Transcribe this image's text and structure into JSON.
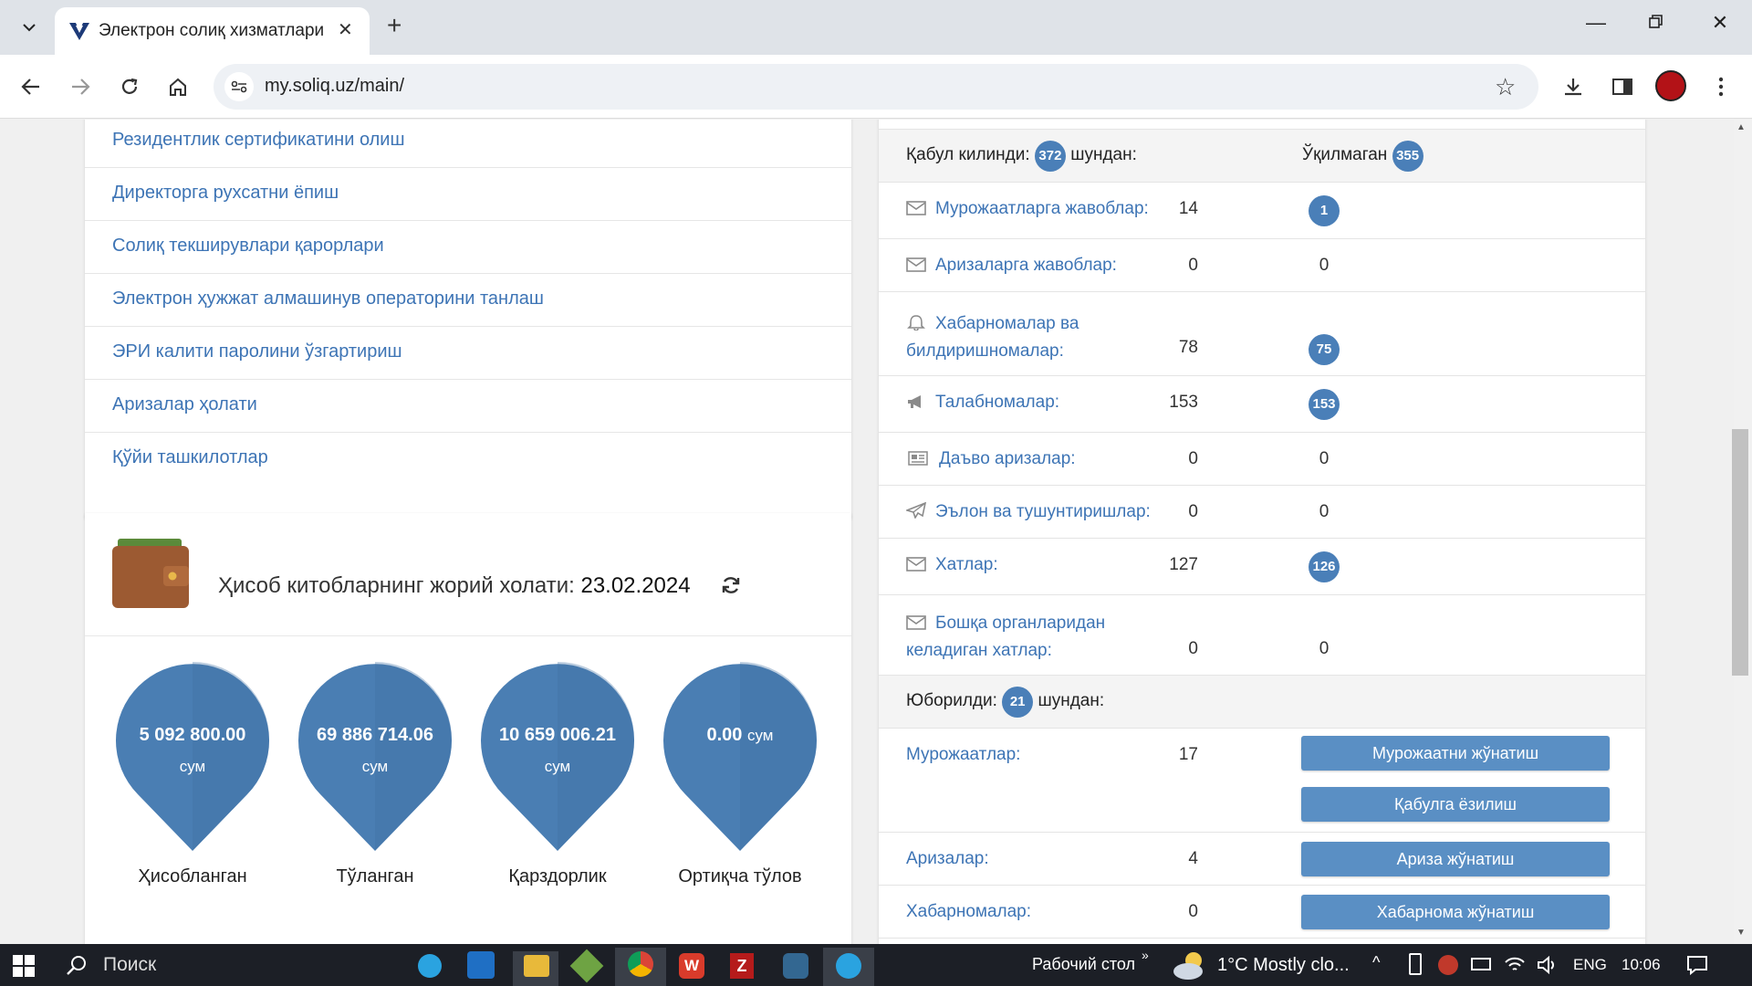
{
  "browser": {
    "tab_title": "Электрон солиқ хизматлари",
    "url": "my.soliq.uz/main/"
  },
  "menu": {
    "items": [
      "Резидентлик сертификатини олиш",
      "Директорга рухсатни ёпиш",
      "Солиқ текширувлари қарорлари",
      "Электрон ҳужжат алмашинув операторини танлаш",
      "ЭРИ калити паролини ўзгартириш",
      "Аризалар ҳолати",
      "Қўйи ташкилотлар"
    ]
  },
  "balance": {
    "title": "Ҳисоб китобларнинг жорий холати:",
    "date": "23.02.2024",
    "drops": [
      {
        "value": "5 092 800.00",
        "unit": "сум",
        "label": "Ҳисобланган"
      },
      {
        "value": "69 886 714.06",
        "unit": "сум",
        "label": "Тўланган"
      },
      {
        "value": "10 659 006.21",
        "unit": "сум",
        "label": "Қарздорлик"
      },
      {
        "value": "0.00",
        "unit": "сум",
        "label": "Ортиқча тўлов"
      }
    ],
    "drop_color": "#4a7eb3"
  },
  "received": {
    "label": "Қабул килинди:",
    "total": "372",
    "of_which": "шундан:",
    "unread_label": "Ўқилмаган",
    "unread_total": "355",
    "rows": [
      {
        "label": "Мурожаатларга жавоблар:",
        "count": "14",
        "unread": "1",
        "unread_badge": true,
        "icon": "envelope-icon"
      },
      {
        "label": "Аризаларга жавоблар:",
        "count": "0",
        "unread": "0",
        "unread_badge": false,
        "icon": "envelope-icon"
      },
      {
        "label": "Хабарномалар ва",
        "label2": "билдиришномалар:",
        "count": "78",
        "unread": "75",
        "unread_badge": true,
        "icon": "bell-icon"
      },
      {
        "label": "Талабномалар:",
        "count": "153",
        "unread": "153",
        "unread_badge": true,
        "icon": "megaphone-icon"
      },
      {
        "label": "Даъво аризалар:",
        "count": "0",
        "unread": "0",
        "unread_badge": false,
        "icon": "newspaper-icon"
      },
      {
        "label": "Эълон ва тушунтиришлар:",
        "count": "0",
        "unread": "0",
        "unread_badge": false,
        "icon": "paper-plane-icon"
      },
      {
        "label": "Хатлар:",
        "count": "127",
        "unread": "126",
        "unread_badge": true,
        "icon": "envelope-icon"
      },
      {
        "label": "Бошқа органларидан",
        "label2": "келадиган хатлар:",
        "count": "0",
        "unread": "0",
        "unread_badge": false,
        "icon": "envelope-icon"
      }
    ]
  },
  "sent": {
    "label": "Юборилди:",
    "total": "21",
    "of_which": "шундан:",
    "rows": [
      {
        "label": "Мурожаатлар:",
        "count": "17",
        "buttons": [
          "Мурожаатни жўнатиш",
          "Қабулга ёзилиш"
        ]
      },
      {
        "label": "Аризалар:",
        "count": "4",
        "buttons": [
          "Ариза жўнатиш"
        ]
      },
      {
        "label": "Хабарномалар:",
        "count": "0",
        "buttons": [
          "Хабарнома жўнатиш"
        ]
      }
    ]
  },
  "taskbar": {
    "search": "Поиск",
    "desktop": "Рабочий стол",
    "weather": "1°C  Mostly clo...",
    "lang": "ENG",
    "time": "10:06"
  }
}
